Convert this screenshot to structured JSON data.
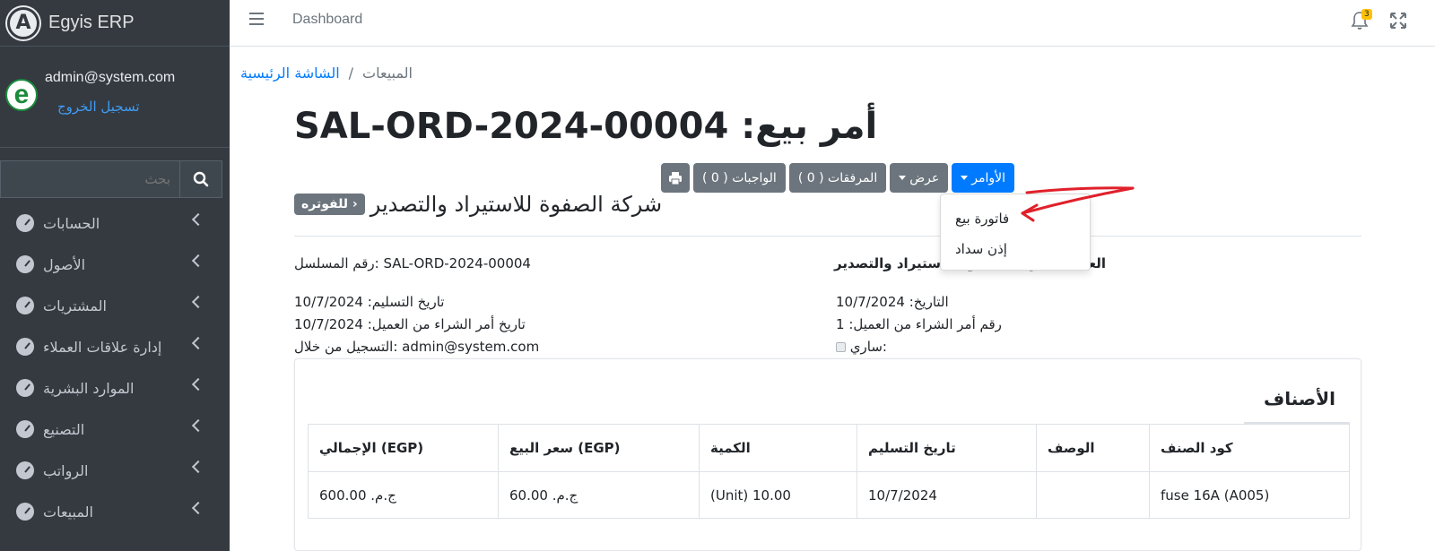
{
  "app": {
    "brand": "Egyis ERP",
    "brand_logo_letter": "A"
  },
  "user": {
    "email": "admin@system.com",
    "logout": "تسجيل الخروج",
    "avatar_letter": "e"
  },
  "sidebar": {
    "search_placeholder": "بحث",
    "items": [
      {
        "label": "الحسابات"
      },
      {
        "label": "الأصول"
      },
      {
        "label": "المشتريات"
      },
      {
        "label": "إدارة علاقات العملاء"
      },
      {
        "label": "الموارد البشرية"
      },
      {
        "label": "التصنيع"
      },
      {
        "label": "الرواتب"
      },
      {
        "label": "المبيعات"
      }
    ]
  },
  "topbar": {
    "dashboard": "Dashboard",
    "notifications_count": "3"
  },
  "breadcrumb": {
    "home": "الشاشة الرئيسية",
    "separator": "/",
    "current": "المبيعات"
  },
  "page": {
    "title": "أمر بيع: SAL-ORD-2024-00004",
    "customer_name": "شركة الصفوة للاستيراد والتصدير",
    "customer_badge": "للفوتره ›"
  },
  "actions": {
    "commands": "الأوامر",
    "view": "عرض",
    "attachments": "المرفقات ( 0 )",
    "tasks": "الواجبات ( 0 )"
  },
  "dropdown": {
    "items": [
      {
        "label": "فاتورة بيع"
      },
      {
        "label": "إذن سداد"
      }
    ]
  },
  "details": {
    "serial": "رقم المسلسل: SAL-ORD-2024-00004",
    "delivery_date": "تاريخ التسليم: 10/7/2024",
    "po_date": "تاريخ أمر الشراء من العميل: 10/7/2024",
    "registered_by": "التسجيل من خلال: admin@system.com",
    "customer": "العميل: شركة الصفوة للاستيراد والتصدير",
    "date": "التاريخ: 10/7/2024",
    "po_number": "رقم أمر الشراء من العميل: 1",
    "active": "ساري:"
  },
  "items_card": {
    "title": "الأصناف",
    "columns": [
      "الإجمالي (EGP)",
      "سعر البيع (EGP)",
      "الكمية",
      "تاريخ التسليم",
      "الوصف",
      "كود الصنف"
    ],
    "rows": [
      [
        "ج.م.‏ 600.00",
        "ج.م.‏ 60.00",
        "(Unit) 10.00",
        "10/7/2024",
        "",
        "fuse 16A (A005)"
      ]
    ]
  },
  "colors": {
    "sidebar_bg": "#343a40",
    "primary": "#007bff",
    "secondary": "#6c757d",
    "annotation": "#e0202a"
  }
}
